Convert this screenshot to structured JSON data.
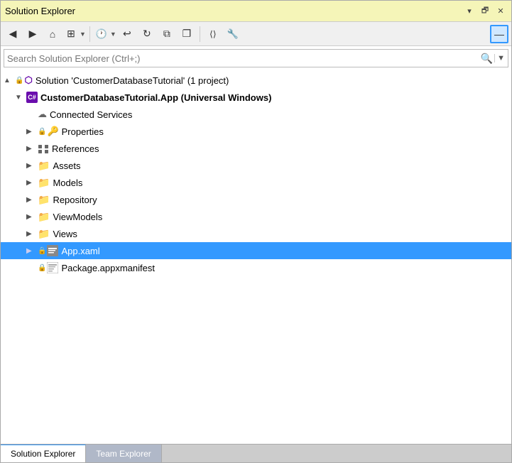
{
  "window": {
    "title": "Solution Explorer",
    "title_controls": {
      "pin": "▾",
      "restore": "🗗",
      "close": "✕"
    }
  },
  "toolbar": {
    "buttons": [
      {
        "name": "back-button",
        "icon": "◀",
        "label": "Back"
      },
      {
        "name": "forward-button",
        "icon": "▶",
        "label": "Forward"
      },
      {
        "name": "home-button",
        "icon": "⌂",
        "label": "Home"
      },
      {
        "name": "switch-views-button",
        "icon": "⊞",
        "label": "Switch Views",
        "has_arrow": true
      },
      {
        "name": "history-button",
        "icon": "🕐",
        "label": "History",
        "has_arrow": true
      },
      {
        "name": "undo-button",
        "icon": "↩",
        "label": "Undo"
      },
      {
        "name": "refresh-button",
        "icon": "↻",
        "label": "Refresh"
      },
      {
        "name": "layers-button",
        "icon": "⧉",
        "label": "Layers"
      },
      {
        "name": "copy-button",
        "icon": "❐",
        "label": "Copy"
      },
      {
        "name": "code-button",
        "icon": "⟨⟩",
        "label": "View Code"
      },
      {
        "name": "tools-button",
        "icon": "🔧",
        "label": "Tools"
      },
      {
        "name": "minimize-button",
        "icon": "—",
        "label": "Minimize",
        "active": true
      }
    ]
  },
  "search": {
    "placeholder": "Search Solution Explorer (Ctrl+;)"
  },
  "tree": {
    "items": [
      {
        "id": "solution",
        "level": 0,
        "label": "Solution 'CustomerDatabaseTutorial' (1 project)",
        "icon": "solution",
        "expanded": true,
        "selected": false
      },
      {
        "id": "project",
        "level": 1,
        "label": "CustomerDatabaseTutorial.App (Universal Windows)",
        "icon": "csharp",
        "expanded": true,
        "selected": false,
        "bold": true
      },
      {
        "id": "connected-services",
        "level": 2,
        "label": "Connected Services",
        "icon": "cloud",
        "expanded": false,
        "selected": false,
        "no_arrow": true
      },
      {
        "id": "properties",
        "level": 2,
        "label": "Properties",
        "icon": "gear",
        "expanded": false,
        "selected": false
      },
      {
        "id": "references",
        "level": 2,
        "label": "References",
        "icon": "ref",
        "expanded": false,
        "selected": false
      },
      {
        "id": "assets",
        "level": 2,
        "label": "Assets",
        "icon": "folder",
        "expanded": false,
        "selected": false
      },
      {
        "id": "models",
        "level": 2,
        "label": "Models",
        "icon": "folder",
        "expanded": false,
        "selected": false
      },
      {
        "id": "repository",
        "level": 2,
        "label": "Repository",
        "icon": "folder",
        "expanded": false,
        "selected": false
      },
      {
        "id": "viewmodels",
        "level": 2,
        "label": "ViewModels",
        "icon": "folder",
        "expanded": false,
        "selected": false
      },
      {
        "id": "views",
        "level": 2,
        "label": "Views",
        "icon": "folder",
        "expanded": false,
        "selected": false
      },
      {
        "id": "app-xaml",
        "level": 2,
        "label": "App.xaml",
        "icon": "xaml",
        "expanded": false,
        "selected": true
      },
      {
        "id": "package-manifest",
        "level": 2,
        "label": "Package.appxmanifest",
        "icon": "manifest",
        "expanded": false,
        "selected": false
      }
    ]
  },
  "bottom_tabs": [
    {
      "id": "solution-explorer",
      "label": "Solution Explorer",
      "active": true
    },
    {
      "id": "team-explorer",
      "label": "Team Explorer",
      "active": false
    }
  ]
}
